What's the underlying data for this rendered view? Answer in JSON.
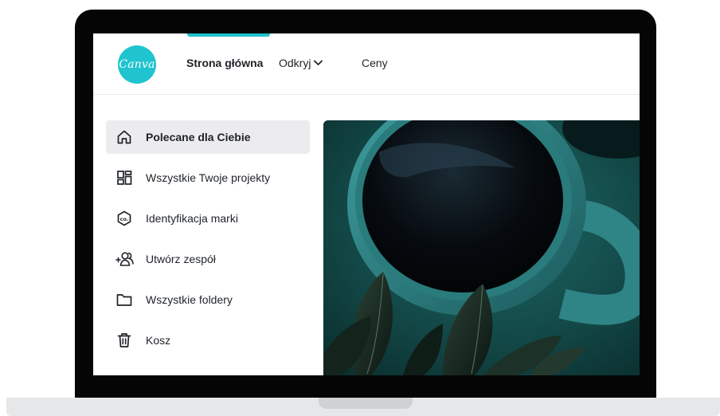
{
  "brand": {
    "logo_text": "Canva",
    "accent_color": "#1fc4cf"
  },
  "nav": {
    "items": [
      {
        "label": "Strona główna",
        "active": true
      },
      {
        "label": "Odkryj",
        "has_dropdown": true
      },
      {
        "label": "Ceny"
      }
    ]
  },
  "sidebar": {
    "items": [
      {
        "label": "Polecane dla Ciebie",
        "icon": "home-icon",
        "active": true
      },
      {
        "label": "Wszystkie Twoje projekty",
        "icon": "grid-icon"
      },
      {
        "label": "Identyfikacja marki",
        "icon": "brand-kit-icon"
      },
      {
        "label": "Utwórz zespół",
        "icon": "add-team-icon"
      },
      {
        "label": "Wszystkie foldery",
        "icon": "folder-icon"
      },
      {
        "label": "Kosz",
        "icon": "trash-icon"
      }
    ]
  },
  "hero": {
    "image": "coffee-cup-with-plant-photo"
  },
  "brand_icon_text": "co."
}
